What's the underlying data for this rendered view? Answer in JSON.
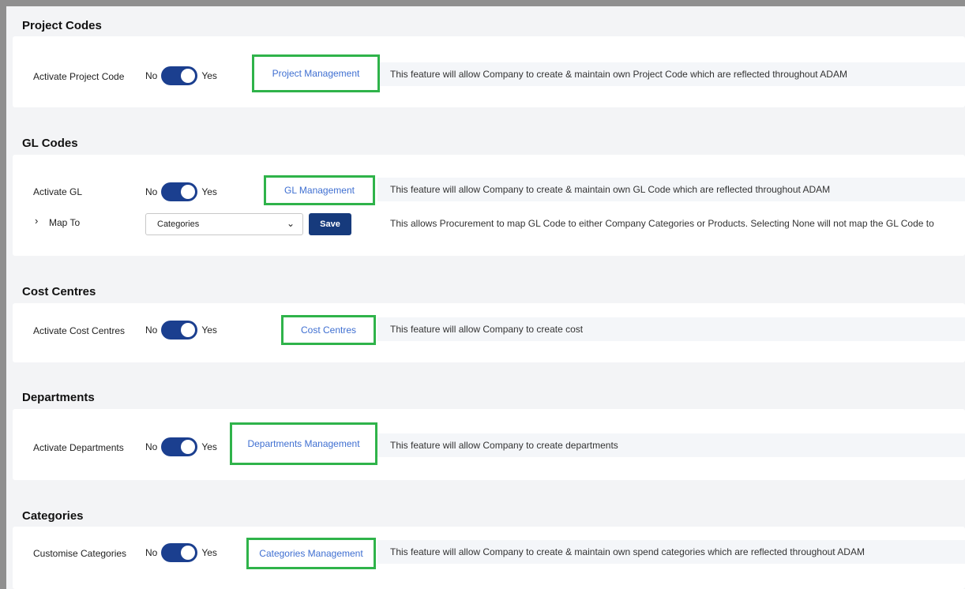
{
  "toggle_no": "No",
  "toggle_yes": "Yes",
  "sections": [
    {
      "title": "Project Codes",
      "label": "Activate Project Code",
      "link": "Project Management",
      "description": "This feature will allow Company to create & maintain own Project Code which are reflected throughout ADAM"
    },
    {
      "title": "GL Codes",
      "label": "Activate GL",
      "link": "GL Management",
      "description": "This feature will allow Company to create & maintain own GL Code which are reflected throughout ADAM",
      "map_to": {
        "label": "Map To",
        "selected": "Categories",
        "save_label": "Save",
        "description": "This allows Procurement to map GL Code to either Company Categories or Products. Selecting None will not map the GL Code to"
      }
    },
    {
      "title": "Cost Centres",
      "label": "Activate Cost Centres",
      "link": "Cost Centres",
      "description": "This feature will allow Company to create cost"
    },
    {
      "title": "Departments",
      "label": "Activate Departments",
      "link": "Departments Management",
      "description": "This feature will allow Company to create departments"
    },
    {
      "title": "Categories",
      "label": "Customise Categories",
      "link": "Categories Management",
      "description": "This feature will allow Company to create & maintain own spend categories which are reflected throughout ADAM"
    }
  ],
  "colors": {
    "toggle_on": "#1b3f8f",
    "highlight_box": "#2fb34a",
    "link": "#3f6fd1",
    "save_button": "#163a7c"
  }
}
